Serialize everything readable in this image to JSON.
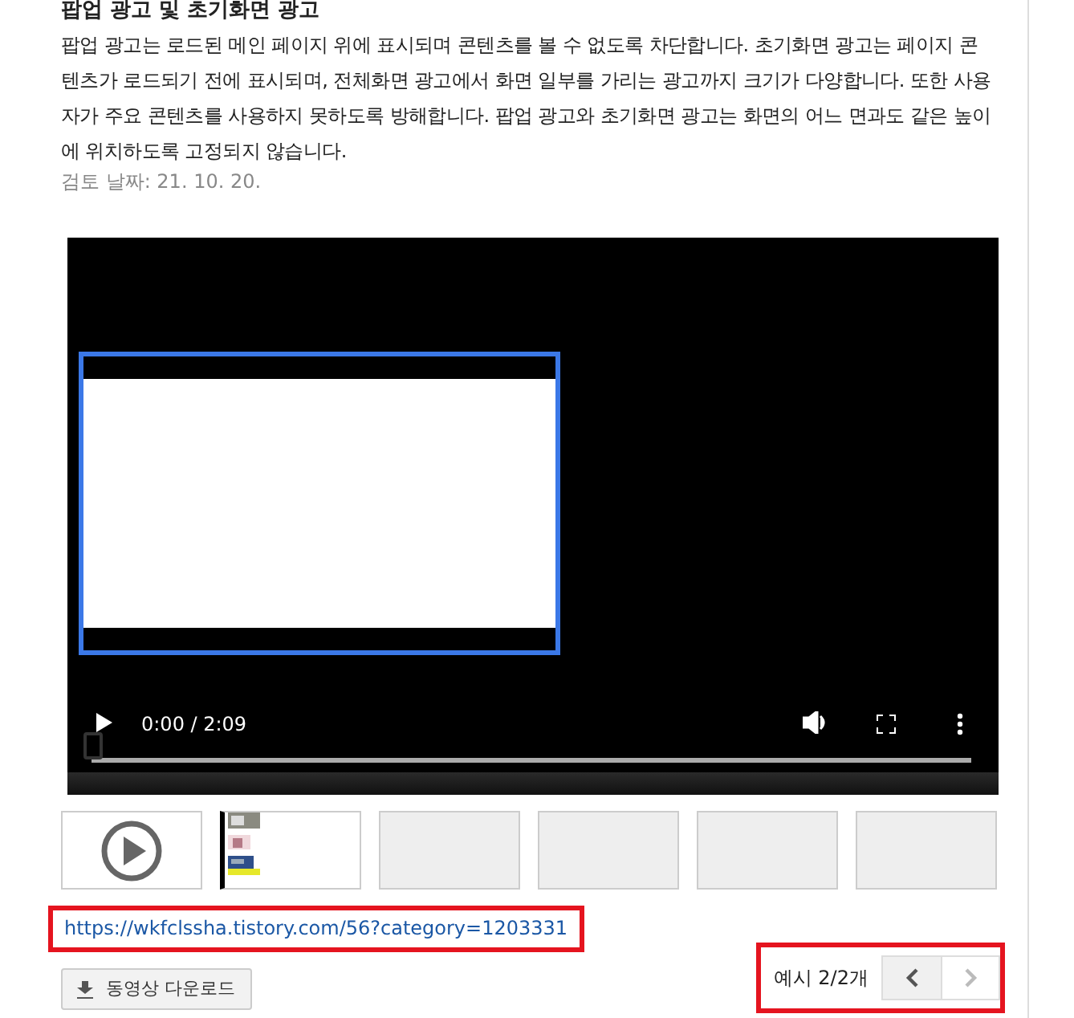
{
  "heading": "팝업 광고 및 초기화면 광고",
  "description": "팝업 광고는 로드된 메인 페이지 위에 표시되며 콘텐츠를 볼 수 없도록 차단합니다. 초기화면 광고는 페이지 콘텐츠가 로드되기 전에 표시되며, 전체화면 광고에서 화면 일부를 가리는 광고까지 크기가 다양합니다. 또한 사용자가 주요 콘텐츠를 사용하지 못하도록 방해합니다. 팝업 광고와 초기화면 광고는 화면의 어느 면과도 같은 높이에 위치하도록 고정되지 않습니다.",
  "review_date": "검토 날짜: 21. 10. 20.",
  "video": {
    "time": "0:00 / 2:09",
    "level": 0
  },
  "thumbnails": [
    {
      "kind": "play",
      "selected": false
    },
    {
      "kind": "picture",
      "selected": true
    },
    {
      "kind": "blank",
      "selected": false
    },
    {
      "kind": "blank",
      "selected": false
    },
    {
      "kind": "blank",
      "selected": false
    },
    {
      "kind": "blank",
      "selected": false
    }
  ],
  "link": {
    "text": "https://wkfclssha.tistory.com/56?category=1203331",
    "highlighted": true
  },
  "download_button": "동영상 다운로드",
  "pager": {
    "label": "예시 2/2개",
    "highlighted": true,
    "prev_disabled": false,
    "next_disabled": true
  }
}
